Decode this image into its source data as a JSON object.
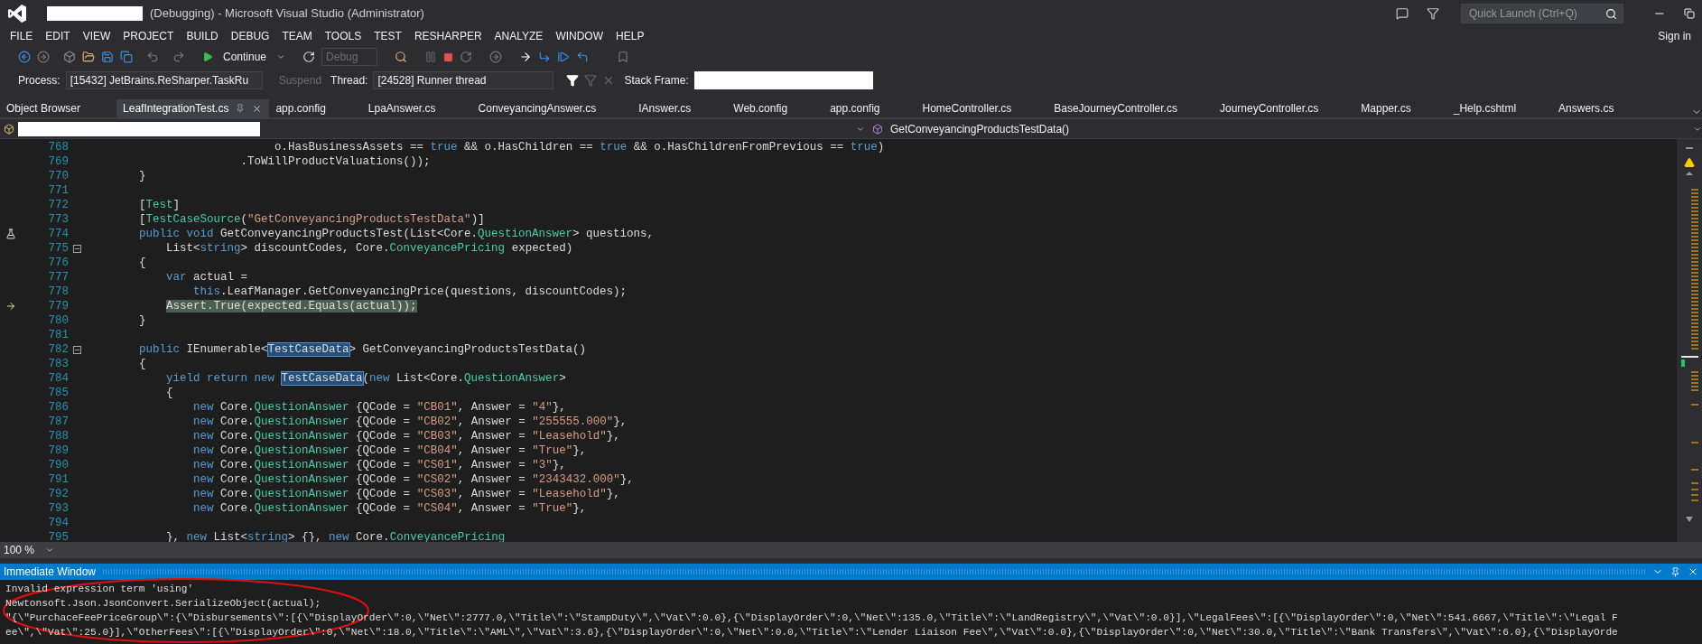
{
  "window": {
    "title": "(Debugging) - Microsoft Visual Studio (Administrator)"
  },
  "quick_launch": {
    "placeholder": "Quick Launch (Ctrl+Q)"
  },
  "menu": [
    "FILE",
    "EDIT",
    "VIEW",
    "PROJECT",
    "BUILD",
    "DEBUG",
    "TEAM",
    "TOOLS",
    "TEST",
    "RESHARPER",
    "ANALYZE",
    "WINDOW",
    "HELP"
  ],
  "account": "Sign in",
  "toolbar": {
    "continue": "Continue",
    "configuration": {
      "value": "Debug",
      "disabled": true
    }
  },
  "debug_location": {
    "process_label": "Process:",
    "process": "[15432] JetBrains.ReSharper.TaskRu",
    "suspend": {
      "label": "Suspend",
      "disabled": true
    },
    "thread_label": "Thread:",
    "thread": "[24528] Runner thread",
    "stack_frame_label": "Stack Frame:"
  },
  "tabs": [
    {
      "label": "Object Browser",
      "selected": false
    },
    {
      "label": "LeafIntegrationTest.cs",
      "selected": true
    },
    {
      "label": "app.config",
      "selected": false
    },
    {
      "label": "LpaAnswer.cs",
      "selected": false
    },
    {
      "label": "ConveyancingAnswer.cs",
      "selected": false
    },
    {
      "label": "IAnswer.cs",
      "selected": false
    },
    {
      "label": "Web.config",
      "selected": false
    },
    {
      "label": "app.config",
      "selected": false
    },
    {
      "label": "HomeController.cs",
      "selected": false
    },
    {
      "label": "BaseJourneyController.cs",
      "selected": false
    },
    {
      "label": "JourneyController.cs",
      "selected": false
    },
    {
      "label": "Mapper.cs",
      "selected": false
    },
    {
      "label": "_Help.cshtml",
      "selected": false
    },
    {
      "label": "Answers.cs",
      "selected": false
    }
  ],
  "navigation": {
    "member": "GetConveyancingProductsTestData()"
  },
  "editor": {
    "zoom": "100 %",
    "lines": [
      {
        "number": "768",
        "tokens": [
          {
            "text": "                            o.HasBusinessAssets == ",
            "kind": "plain"
          },
          {
            "text": "true",
            "kind": "keyword"
          },
          {
            "text": " && o.HasChildren == ",
            "kind": "plain"
          },
          {
            "text": "true",
            "kind": "keyword"
          },
          {
            "text": " && o.HasChildrenFromPrevious == ",
            "kind": "plain"
          },
          {
            "text": "true",
            "kind": "keyword"
          },
          {
            "text": ")",
            "kind": "plain"
          }
        ]
      },
      {
        "number": "769",
        "tokens": [
          {
            "text": "                       .ToWillProductValuations());",
            "kind": "plain"
          }
        ]
      },
      {
        "number": "770",
        "tokens": [
          {
            "text": "        }",
            "kind": "plain"
          }
        ]
      },
      {
        "number": "771"
      },
      {
        "number": "772",
        "tokens": [
          {
            "text": "        [",
            "kind": "plain"
          },
          {
            "text": "Test",
            "kind": "type"
          },
          {
            "text": "]",
            "kind": "plain"
          }
        ]
      },
      {
        "number": "773",
        "tokens": [
          {
            "text": "        [",
            "kind": "plain"
          },
          {
            "text": "TestCaseSource",
            "kind": "type"
          },
          {
            "text": "(",
            "kind": "plain"
          },
          {
            "text": "\"GetConveyancingProductsTestData\"",
            "kind": "string"
          },
          {
            "text": ")]",
            "kind": "plain"
          }
        ]
      },
      {
        "number": "774",
        "test_marker": true,
        "tokens": [
          {
            "text": "        public void ",
            "kind": "keyword"
          },
          {
            "text": "GetConveyancingProductsTest(List<Core.",
            "kind": "plain"
          },
          {
            "text": "QuestionAnswer",
            "kind": "type"
          },
          {
            "text": "> questions,",
            "kind": "plain"
          }
        ]
      },
      {
        "number": "775",
        "fold": true,
        "tokens": [
          {
            "text": "            List<",
            "kind": "plain"
          },
          {
            "text": "string",
            "kind": "keyword"
          },
          {
            "text": "> discountCodes, Core.",
            "kind": "plain"
          },
          {
            "text": "ConveyancePricing",
            "kind": "type"
          },
          {
            "text": " expected)",
            "kind": "plain"
          }
        ]
      },
      {
        "number": "776",
        "tokens": [
          {
            "text": "        {",
            "kind": "plain"
          }
        ]
      },
      {
        "number": "777",
        "tokens": [
          {
            "text": "            var ",
            "kind": "keyword"
          },
          {
            "text": "actual =",
            "kind": "plain"
          }
        ]
      },
      {
        "number": "778",
        "tokens": [
          {
            "text": "                this",
            "kind": "keyword"
          },
          {
            "text": ".LeafManager.GetConveyancingPrice(questions, discountCodes);",
            "kind": "plain"
          }
        ]
      },
      {
        "number": "779",
        "current_statement": true,
        "tokens": [
          {
            "text": "            Assert.True(expected.Equals(actual));",
            "kind": "current"
          }
        ]
      },
      {
        "number": "780",
        "tokens": [
          {
            "text": "        }",
            "kind": "plain"
          }
        ]
      },
      {
        "number": "781"
      },
      {
        "number": "782",
        "fold": true,
        "tokens": [
          {
            "text": "        public ",
            "kind": "keyword"
          },
          {
            "text": "IEnumerable<",
            "kind": "plain"
          },
          {
            "text": "TestCaseData",
            "kind": "reference"
          },
          {
            "text": "> GetConveyancingProductsTestData()",
            "kind": "plain"
          }
        ]
      },
      {
        "number": "783",
        "tokens": [
          {
            "text": "        {",
            "kind": "plain"
          }
        ]
      },
      {
        "number": "784",
        "tokens": [
          {
            "text": "            yield return new ",
            "kind": "keyword"
          },
          {
            "text": "TestCaseData",
            "kind": "reference"
          },
          {
            "text": "(",
            "kind": "plain"
          },
          {
            "text": "new ",
            "kind": "keyword"
          },
          {
            "text": "List<Core.",
            "kind": "plain"
          },
          {
            "text": "QuestionAnswer",
            "kind": "type"
          },
          {
            "text": ">",
            "kind": "plain"
          }
        ]
      },
      {
        "number": "785",
        "tokens": [
          {
            "text": "            {",
            "kind": "plain"
          }
        ]
      },
      {
        "number": "786",
        "tokens": [
          {
            "text": "                new ",
            "kind": "keyword"
          },
          {
            "text": "Core.",
            "kind": "plain"
          },
          {
            "text": "QuestionAnswer",
            "kind": "type"
          },
          {
            "text": " {QCode = ",
            "kind": "plain"
          },
          {
            "text": "\"CB01\"",
            "kind": "string"
          },
          {
            "text": ", Answer = ",
            "kind": "plain"
          },
          {
            "text": "\"4\"",
            "kind": "string"
          },
          {
            "text": "},",
            "kind": "plain"
          }
        ]
      },
      {
        "number": "787",
        "tokens": [
          {
            "text": "                new ",
            "kind": "keyword"
          },
          {
            "text": "Core.",
            "kind": "plain"
          },
          {
            "text": "QuestionAnswer",
            "kind": "type"
          },
          {
            "text": " {QCode = ",
            "kind": "plain"
          },
          {
            "text": "\"CB02\"",
            "kind": "string"
          },
          {
            "text": ", Answer = ",
            "kind": "plain"
          },
          {
            "text": "\"255555.000\"",
            "kind": "string"
          },
          {
            "text": "},",
            "kind": "plain"
          }
        ]
      },
      {
        "number": "788",
        "tokens": [
          {
            "text": "                new ",
            "kind": "keyword"
          },
          {
            "text": "Core.",
            "kind": "plain"
          },
          {
            "text": "QuestionAnswer",
            "kind": "type"
          },
          {
            "text": " {QCode = ",
            "kind": "plain"
          },
          {
            "text": "\"CB03\"",
            "kind": "string"
          },
          {
            "text": ", Answer = ",
            "kind": "plain"
          },
          {
            "text": "\"Leasehold\"",
            "kind": "string"
          },
          {
            "text": "},",
            "kind": "plain"
          }
        ]
      },
      {
        "number": "789",
        "tokens": [
          {
            "text": "                new ",
            "kind": "keyword"
          },
          {
            "text": "Core.",
            "kind": "plain"
          },
          {
            "text": "QuestionAnswer",
            "kind": "type"
          },
          {
            "text": " {QCode = ",
            "kind": "plain"
          },
          {
            "text": "\"CB04\"",
            "kind": "string"
          },
          {
            "text": ", Answer = ",
            "kind": "plain"
          },
          {
            "text": "\"True\"",
            "kind": "string"
          },
          {
            "text": "},",
            "kind": "plain"
          }
        ]
      },
      {
        "number": "790",
        "tokens": [
          {
            "text": "                new ",
            "kind": "keyword"
          },
          {
            "text": "Core.",
            "kind": "plain"
          },
          {
            "text": "QuestionAnswer",
            "kind": "type"
          },
          {
            "text": " {QCode = ",
            "kind": "plain"
          },
          {
            "text": "\"CS01\"",
            "kind": "string"
          },
          {
            "text": ", Answer = ",
            "kind": "plain"
          },
          {
            "text": "\"3\"",
            "kind": "string"
          },
          {
            "text": "},",
            "kind": "plain"
          }
        ]
      },
      {
        "number": "791",
        "tokens": [
          {
            "text": "                new ",
            "kind": "keyword"
          },
          {
            "text": "Core.",
            "kind": "plain"
          },
          {
            "text": "QuestionAnswer",
            "kind": "type"
          },
          {
            "text": " {QCode = ",
            "kind": "plain"
          },
          {
            "text": "\"CS02\"",
            "kind": "string"
          },
          {
            "text": ", Answer = ",
            "kind": "plain"
          },
          {
            "text": "\"2343432.000\"",
            "kind": "string"
          },
          {
            "text": "},",
            "kind": "plain"
          }
        ]
      },
      {
        "number": "792",
        "tokens": [
          {
            "text": "                new ",
            "kind": "keyword"
          },
          {
            "text": "Core.",
            "kind": "plain"
          },
          {
            "text": "QuestionAnswer",
            "kind": "type"
          },
          {
            "text": " {QCode = ",
            "kind": "plain"
          },
          {
            "text": "\"CS03\"",
            "kind": "string"
          },
          {
            "text": ", Answer = ",
            "kind": "plain"
          },
          {
            "text": "\"Leasehold\"",
            "kind": "string"
          },
          {
            "text": "},",
            "kind": "plain"
          }
        ]
      },
      {
        "number": "793",
        "tokens": [
          {
            "text": "                new ",
            "kind": "keyword"
          },
          {
            "text": "Core.",
            "kind": "plain"
          },
          {
            "text": "QuestionAnswer",
            "kind": "type"
          },
          {
            "text": " {QCode = ",
            "kind": "plain"
          },
          {
            "text": "\"CS04\"",
            "kind": "string"
          },
          {
            "text": ", Answer = ",
            "kind": "plain"
          },
          {
            "text": "\"True\"",
            "kind": "string"
          },
          {
            "text": "},",
            "kind": "plain"
          }
        ]
      },
      {
        "number": "794"
      },
      {
        "number": "795",
        "tokens": [
          {
            "text": "            }, ",
            "kind": "plain"
          },
          {
            "text": "new ",
            "kind": "keyword"
          },
          {
            "text": "List<",
            "kind": "plain"
          },
          {
            "text": "string",
            "kind": "keyword"
          },
          {
            "text": "> {}, ",
            "kind": "plain"
          },
          {
            "text": "new ",
            "kind": "keyword"
          },
          {
            "text": "Core.",
            "kind": "plain"
          },
          {
            "text": "ConveyancePricing",
            "kind": "type"
          }
        ]
      }
    ]
  },
  "immediate_window": {
    "title": "Immediate Window",
    "lines": [
      "Invalid expression term 'using'",
      "Newtonsoft.Json.JsonConvert.SerializeObject(actual);",
      "\"{\\\"PurchaceFeePriceGroup\\\":{\\\"Disbursements\\\":[{\\\"DisplayOrder\\\":0,\\\"Net\\\":2777.0,\\\"Title\\\":\\\"StampDuty\\\",\\\"Vat\\\":0.0},{\\\"DisplayOrder\\\":0,\\\"Net\\\":135.0,\\\"Title\\\":\\\"LandRegistry\\\",\\\"Vat\\\":0.0}],\\\"LegalFees\\\":[{\\\"DisplayOrder\\\":0,\\\"Net\\\":541.6667,\\\"Title\\\":\\\"Legal F",
      "ee\\\",\\\"Vat\\\":25.0}],\\\"OtherFees\\\":[{\\\"DisplayOrder\\\":0,\\\"Net\\\":18.0,\\\"Title\\\":\\\"AML\\\",\\\"Vat\\\":3.6},{\\\"DisplayOrder\\\":0,\\\"Net\\\":0.0,\\\"Title\\\":\\\"Lender Liaison Fee\\\",\\\"Vat\\\":0.0},{\\\"DisplayOrder\\\":0,\\\"Net\\\":30.0,\\\"Title\\\":\\\"Bank Transfers\\\",\\\"Vat\\\":6.0},{\\\"DisplayOrde"
    ]
  }
}
